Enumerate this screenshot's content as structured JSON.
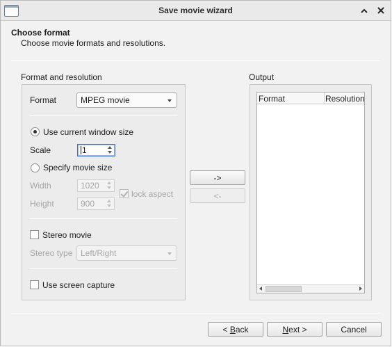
{
  "window": {
    "title": "Save movie wizard"
  },
  "header": {
    "title": "Choose format",
    "subtitle": "Choose movie formats and resolutions."
  },
  "format_group": {
    "label": "Format and resolution",
    "format_label": "Format",
    "format_value": "MPEG movie",
    "use_window_size_label": "Use current window size",
    "use_window_size_checked": true,
    "scale_label": "Scale",
    "scale_value": "1",
    "specify_size_label": "Specify movie size",
    "specify_size_checked": false,
    "width_label": "Width",
    "width_value": "1020",
    "height_label": "Height",
    "height_value": "900",
    "lock_aspect_label": "lock aspect",
    "lock_aspect_checked": true,
    "stereo_label": "Stereo movie",
    "stereo_checked": false,
    "stereo_type_label": "Stereo type",
    "stereo_type_value": "Left/Right",
    "screen_capture_label": "Use screen capture",
    "screen_capture_checked": false
  },
  "transfer": {
    "add_label": "->",
    "remove_label": "<-"
  },
  "output_group": {
    "label": "Output",
    "columns": [
      "Format",
      "Resolution"
    ],
    "rows": []
  },
  "footer": {
    "back_prefix": "< ",
    "back_mnemonic": "B",
    "back_rest": "ack",
    "next_mnemonic": "N",
    "next_rest": "ext >",
    "cancel_label": "Cancel"
  }
}
